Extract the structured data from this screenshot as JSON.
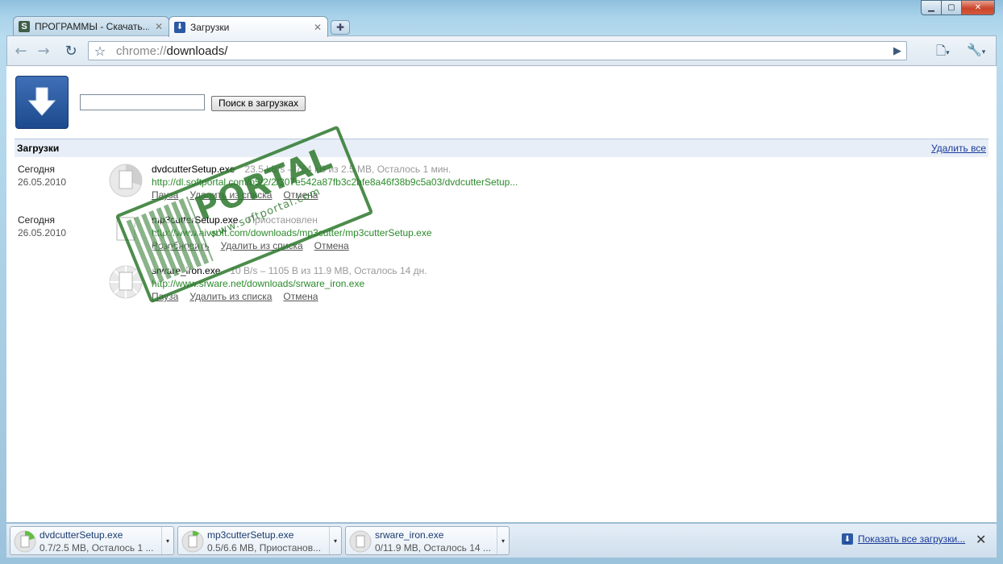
{
  "window": {
    "minimize_icon": "minimize-icon",
    "maximize_icon": "maximize-icon",
    "close_icon": "close-icon"
  },
  "tabs": [
    {
      "title": "ПРОГРАММЫ - Скачать...",
      "favicon": "S",
      "active": false
    },
    {
      "title": "Загрузки",
      "favicon": "download-icon",
      "active": true
    }
  ],
  "toolbar": {
    "url_scheme": "chrome://",
    "url_path": "downloads/"
  },
  "page": {
    "search_button": "Поиск в загрузках",
    "search_value": "",
    "header_title": "Загрузки",
    "clear_all": "Удалить все"
  },
  "downloads": [
    {
      "date_label": "Сегодня",
      "date": "26.05.2010",
      "file": "dvdcutterSetup.exe",
      "status": "23.5 kB/s – 764 kB из 2.5 MB, Осталось 1 мин.",
      "url": "http://dl.softportal.com/b5/2/2/307e542a87fb3c2bfe8a46f38b9c5a03/dvdcutterSetup...",
      "actions": [
        "Пауза",
        "Удалить из списка",
        "Отмена"
      ],
      "progress": 0.3
    },
    {
      "date_label": "Сегодня",
      "date": "26.05.2010",
      "file": "mp3cutterSetup.exe",
      "status": "Приостановлен",
      "url": "http://www.aivsoft.com/downloads/mp3cutter/mp3cutterSetup.exe",
      "actions": [
        "Возобновить",
        "Удалить из списка",
        "Отмена"
      ],
      "progress": 0.08
    },
    {
      "date_label": "",
      "date": "",
      "file": "srware_iron.exe",
      "status": "10 B/s – 1105 B из 11.9 MB, Осталось 14 дн.",
      "url": "http://www.srware.net/downloads/srware_iron.exe",
      "actions": [
        "Пауза",
        "Удалить из списка",
        "Отмена"
      ],
      "progress": 0.0
    }
  ],
  "watermark": {
    "big": "PORTAL",
    "small": "www.softportal.com",
    "tm": "TM"
  },
  "shelf": {
    "items": [
      {
        "name": "dvdcutterSetup.exe",
        "status": "0.7/2.5 MB, Осталось 1 ..."
      },
      {
        "name": "mp3cutterSetup.exe",
        "status": "0.5/6.6 MB, Приостанов..."
      },
      {
        "name": "srware_iron.exe",
        "status": "0/11.9 MB, Осталось 14 ..."
      }
    ],
    "show_all": "Показать все загрузки...",
    "close": "✕"
  },
  "colors": {
    "link_green": "#2b8a2b",
    "link_blue": "#1a3a99",
    "header_bg": "#e8eef7"
  }
}
